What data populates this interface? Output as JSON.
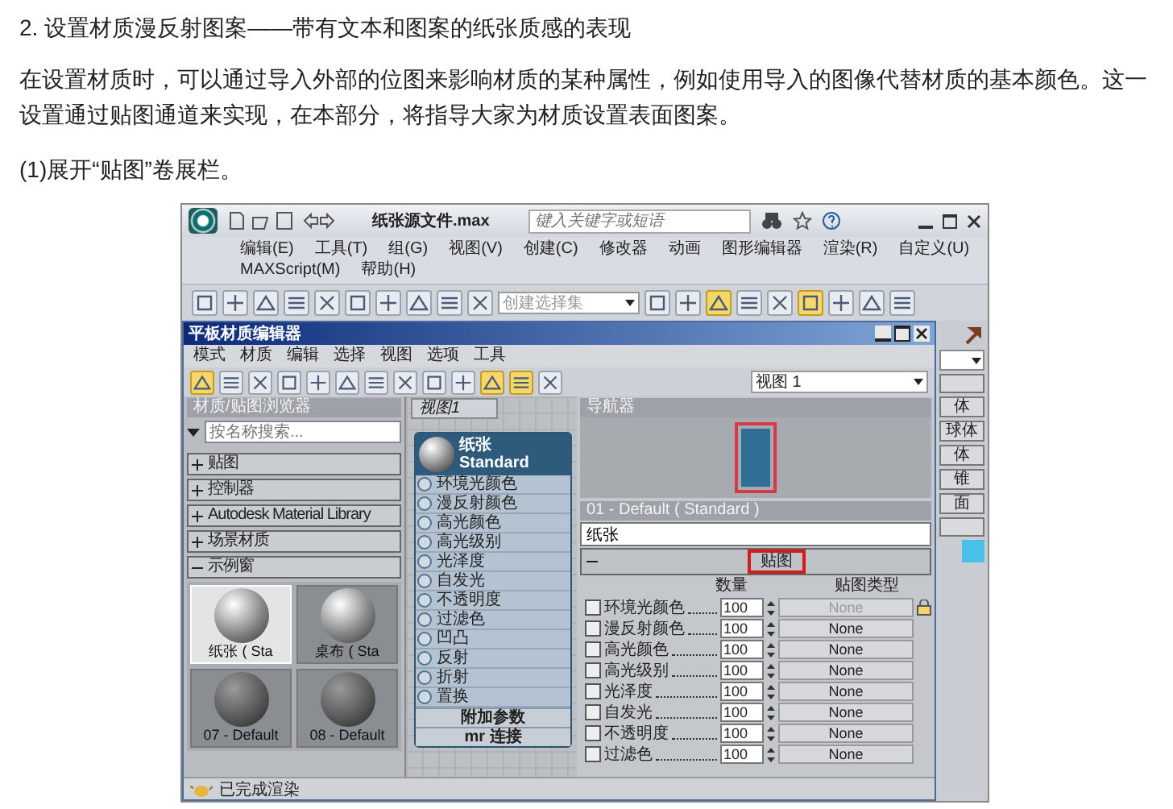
{
  "article": {
    "heading": "2. 设置材质漫反射图案——带有文本和图案的纸张质感的表现",
    "paragraph": "在设置材质时，可以通过导入外部的位图来影响材质的某种属性，例如使用导入的图像代替材质的基本颜色。这一设置通过贴图通道来实现，在本部分，将指导大家为材质设置表面图案。",
    "step": "(1)展开“贴图”卷展栏。"
  },
  "app": {
    "title": "纸张源文件.max",
    "search": {
      "placeholder": "键入关键字或短语"
    },
    "menu": [
      "编辑(E)",
      "工具(T)",
      "组(G)",
      "视图(V)",
      "创建(C)",
      "修改器",
      "动画",
      "图形编辑器",
      "渲染(R)",
      "自定义(U)",
      "MAXScript(M)",
      "帮助(H)"
    ],
    "toolbar": [
      {
        "selected": false
      },
      {
        "selected": false
      },
      {
        "selected": false
      },
      {
        "selected": false
      },
      {
        "selected": false
      },
      {
        "selected": false
      },
      {
        "selected": false
      },
      {
        "selected": false
      },
      {
        "selected": false
      },
      {
        "selected": false
      },
      {
        "selected": false
      },
      {
        "selected": false
      },
      {
        "selected": true
      },
      {
        "selected": false
      },
      {
        "selected": false
      },
      {
        "selected": true
      },
      {
        "selected": false
      },
      {
        "selected": false
      },
      {
        "selected": false
      }
    ],
    "selection_set": {
      "placeholder": "创建选择集"
    }
  },
  "editor": {
    "title": "平板材质编辑器",
    "menu": [
      "模式",
      "材质",
      "编辑",
      "选择",
      "视图",
      "选项",
      "工具"
    ],
    "toolbar": [
      {
        "selected": true
      },
      {
        "selected": false
      },
      {
        "selected": false
      },
      {
        "selected": false
      },
      {
        "selected": false
      },
      {
        "selected": false
      },
      {
        "selected": false
      },
      {
        "selected": false
      },
      {
        "selected": false
      },
      {
        "selected": false
      },
      {
        "selected": true
      },
      {
        "selected": true
      },
      {
        "selected": false
      }
    ],
    "view_dropdown": "视图 1",
    "browser": {
      "title": "材质/贴图浏览器",
      "search": {
        "placeholder": "按名称搜索..."
      },
      "rollouts": [
        {
          "label": "贴图",
          "expanded": false
        },
        {
          "label": "控制器",
          "expanded": false
        },
        {
          "label": "Autodesk Material Library",
          "expanded": false
        },
        {
          "label": "场景材质",
          "expanded": false
        },
        {
          "label": "示例窗",
          "expanded": true
        }
      ],
      "swatches": [
        {
          "label": "纸张 ( Sta",
          "selected": true
        },
        {
          "label": "桌布 ( Sta",
          "selected": false
        },
        {
          "label": "07 - Default",
          "selected": false
        },
        {
          "label": "08 - Default",
          "selected": false
        }
      ]
    },
    "view_tab": "视图1",
    "node": {
      "name": "纸张",
      "type": "Standard",
      "slots": [
        "环境光颜色",
        "漫反射颜色",
        "高光颜色",
        "高光级别",
        "光泽度",
        "自发光",
        "不透明度",
        "过滤色",
        "凹凸",
        "反射",
        "折射",
        "置换"
      ],
      "footer": [
        "附加参数",
        "mr 连接"
      ]
    },
    "navigator": {
      "title": "导航器"
    },
    "params": {
      "title": "01 - Default ( Standard )",
      "name": "纸张",
      "rollout": {
        "label": "贴图",
        "expanded": true,
        "highlighted": true
      },
      "columns": [
        "数量",
        "贴图类型"
      ],
      "rows": [
        {
          "label": "环境光颜色",
          "checked": false,
          "amount": "100",
          "map": "None",
          "disabled": true
        },
        {
          "label": "漫反射颜色",
          "checked": false,
          "amount": "100",
          "map": "None",
          "disabled": false
        },
        {
          "label": "高光颜色",
          "checked": false,
          "amount": "100",
          "map": "None",
          "disabled": false
        },
        {
          "label": "高光级别",
          "checked": false,
          "amount": "100",
          "map": "None",
          "disabled": false
        },
        {
          "label": "光泽度",
          "checked": false,
          "amount": "100",
          "map": "None",
          "disabled": false
        },
        {
          "label": "自发光",
          "checked": false,
          "amount": "100",
          "map": "None",
          "disabled": false
        },
        {
          "label": "不透明度",
          "checked": false,
          "amount": "100",
          "map": "None",
          "disabled": false
        },
        {
          "label": "过滤色",
          "checked": false,
          "amount": "100",
          "map": "None",
          "disabled": false
        }
      ]
    },
    "status": "已完成渲染"
  },
  "command_panel": {
    "buttons": [
      "体",
      "球体",
      "体",
      "锥",
      "面"
    ]
  }
}
